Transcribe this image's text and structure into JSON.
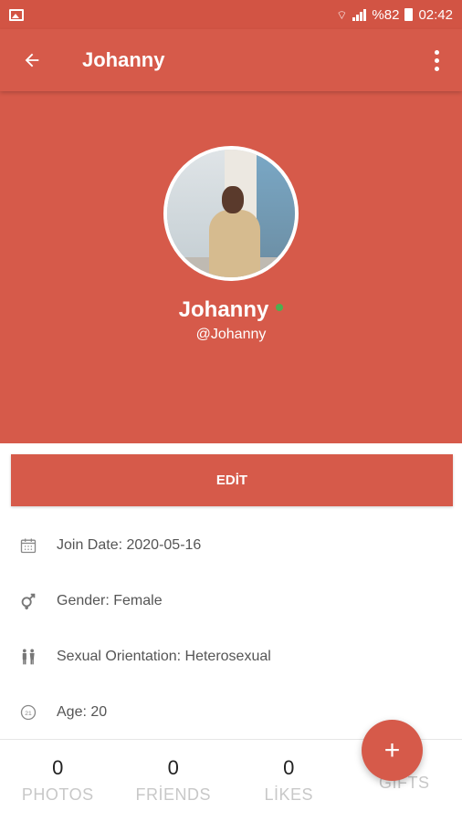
{
  "status_bar": {
    "battery": "%82",
    "time": "02:42"
  },
  "app_bar": {
    "title": "Johanny"
  },
  "profile": {
    "name": "Johanny",
    "handle": "@Johanny",
    "online": true
  },
  "edit_button": {
    "label": "EDİT"
  },
  "info": [
    {
      "icon": "calendar-icon",
      "text": "Join Date: 2020-05-16"
    },
    {
      "icon": "gender-icon",
      "text": "Gender: Female"
    },
    {
      "icon": "orientation-icon",
      "text": "Sexual Orientation: Heterosexual"
    },
    {
      "icon": "age-icon",
      "text": "Age: 20"
    }
  ],
  "stats": [
    {
      "count": "0",
      "label": "PHOTOS"
    },
    {
      "count": "0",
      "label": "FRİENDS"
    },
    {
      "count": "0",
      "label": "LİKES"
    },
    {
      "count": "",
      "label": "GİFTS"
    }
  ],
  "fab": {
    "label": "+"
  },
  "colors": {
    "primary": "#d65a4a",
    "status_bar": "#d25444",
    "online": "#4caf50"
  }
}
